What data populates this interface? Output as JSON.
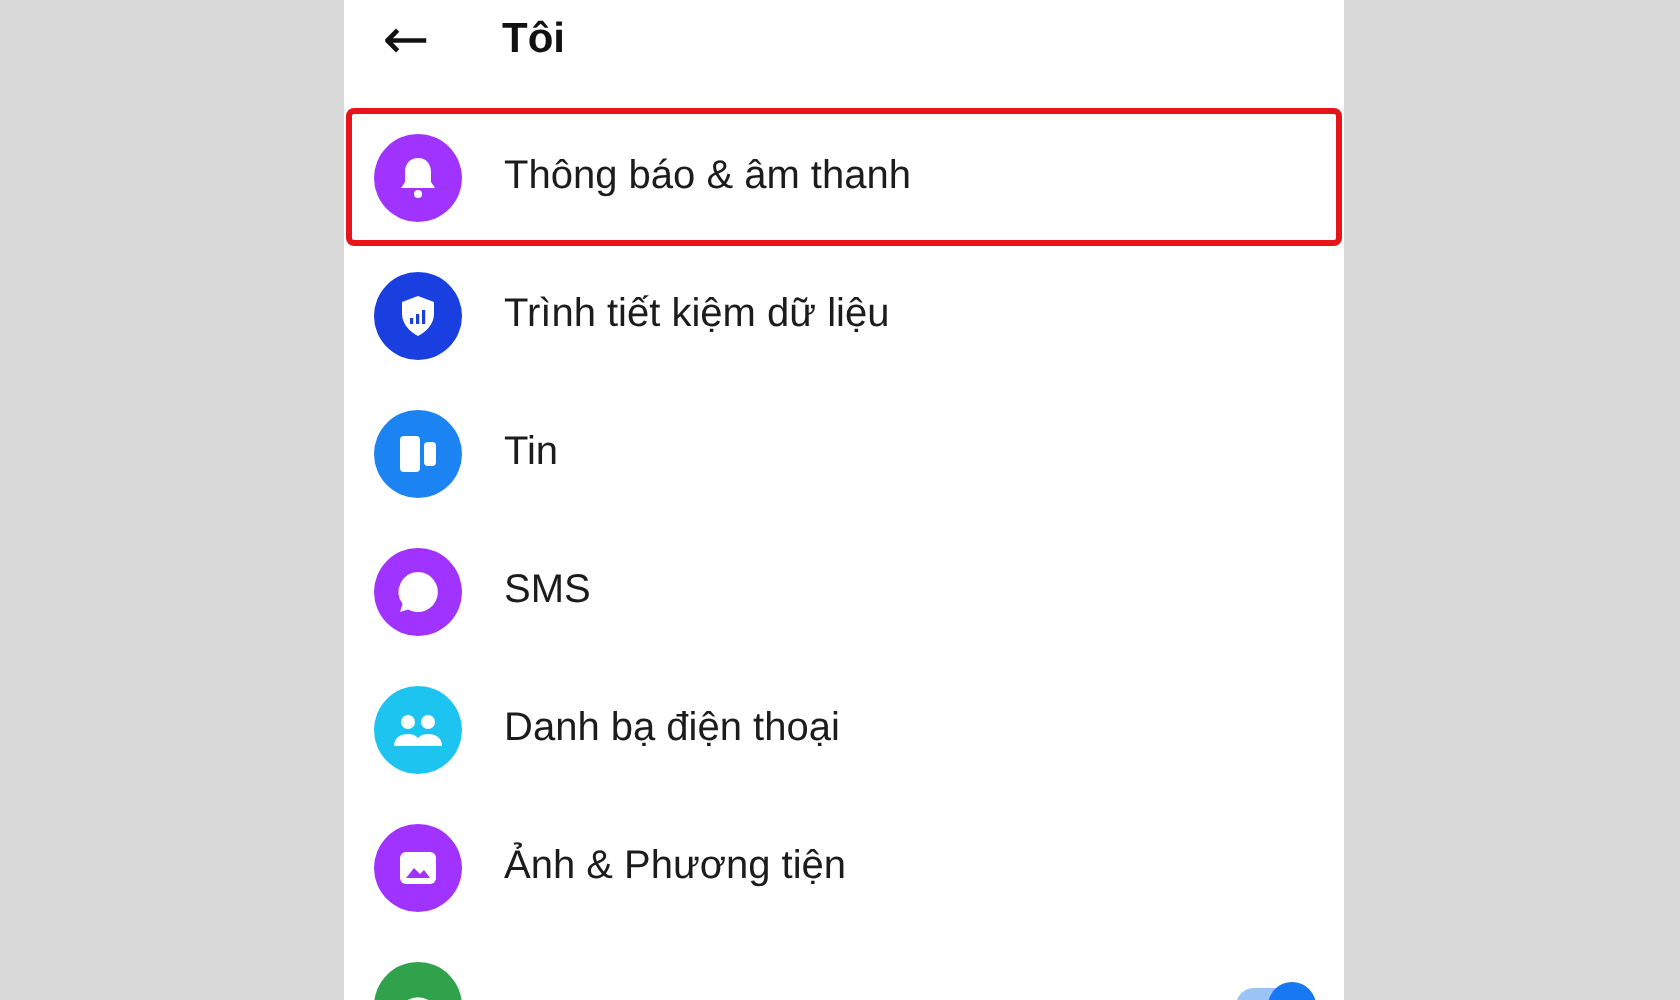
{
  "header": {
    "back": "←",
    "title": "Tôi"
  },
  "items": [
    {
      "kind": "bell",
      "label": "Thông báo & âm thanh",
      "color": "#a033ff",
      "highlighted": true
    },
    {
      "kind": "shield",
      "label": "Trình tiết kiệm dữ liệu",
      "color": "#1a3fe0",
      "highlighted": false
    },
    {
      "kind": "stories",
      "label": "Tin",
      "color": "#1b84f2",
      "highlighted": false
    },
    {
      "kind": "chat",
      "label": "SMS",
      "color": "#a033ff",
      "highlighted": false
    },
    {
      "kind": "contacts",
      "label": "Danh bạ điện thoại",
      "color": "#1ec4f0",
      "highlighted": false
    },
    {
      "kind": "photo",
      "label": "Ảnh & Phương tiện",
      "color": "#a033ff",
      "highlighted": false
    }
  ],
  "partial_row": {
    "color": "#31a24c",
    "on": true
  }
}
